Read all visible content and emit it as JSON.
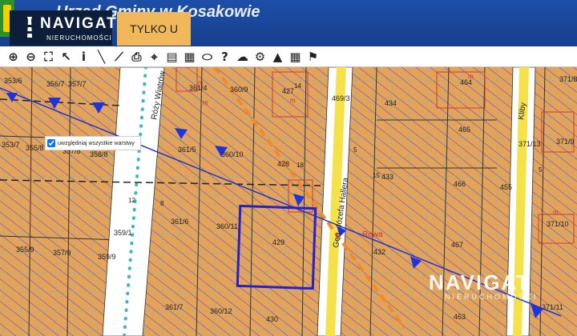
{
  "header": {
    "title": "Urząd Gminy w Kosakowie",
    "logo_brand": "NAVIGAT",
    "logo_subtitle": "NIERUCHOMOŚCI",
    "badge": "TYLKO U NAS"
  },
  "toolbar": {
    "tools": [
      "zoom-in-icon",
      "zoom-out-icon",
      "zoom-extent-icon",
      "select-arrow-icon",
      "info-icon",
      "measure-line-icon",
      "measure-area-icon",
      "print-icon",
      "identify-icon",
      "layers-icon",
      "layout-icon",
      "comment-icon",
      "help-icon",
      "cloud-icon",
      "settings-icon",
      "rgb-icon",
      "legend-icon",
      "streetview-icon"
    ],
    "glyphs": [
      "⊕",
      "⊖",
      "⛶",
      "↖",
      "i",
      "╲",
      "⟋",
      "⎙",
      "⌖",
      "▤",
      "▦",
      "⬭",
      "?",
      "☁",
      "⚙",
      "▲",
      "▦",
      "⚑"
    ]
  },
  "layer_panel": {
    "label": "uwzględniaj wszystkie warstwy",
    "checked": true
  },
  "map": {
    "parcel_labels": [
      "353/6",
      "356/7",
      "357/7",
      "361/4",
      "360/9",
      "427",
      "469/3",
      "434",
      "464",
      "371/8",
      "353/7",
      "355/8",
      "357/8",
      "358/8",
      "361/5",
      "360/10",
      "428",
      "465",
      "371/13",
      "371/9",
      "433",
      "466",
      "455",
      "361/6",
      "360/11",
      "429",
      "359/1",
      "355/9",
      "357/9",
      "359/9",
      "467",
      "371/10",
      "371/11",
      "361/7",
      "360/12",
      "430",
      "463",
      "432"
    ],
    "street_labels": [
      "Róży Wiatrów",
      "Gen. Józefa Hallera",
      "Kliby"
    ],
    "markers": [
      "m",
      "m",
      "m",
      "m",
      "m",
      "12",
      "8",
      "5",
      "5",
      "15",
      "14",
      "18"
    ],
    "feature_label": "Rewa"
  },
  "watermark": {
    "brand": "NAVIGAT",
    "subtitle": "NIERUCHOMOŚCI"
  },
  "colors": {
    "parcel_fill": "#e3a35a",
    "grid": "#7fb7b0",
    "hatch": "#5a4ab5",
    "route": "#f08a2a",
    "selection": "#2222cc",
    "road_fill": "#ffffff",
    "road_center": "#f5e24a"
  }
}
